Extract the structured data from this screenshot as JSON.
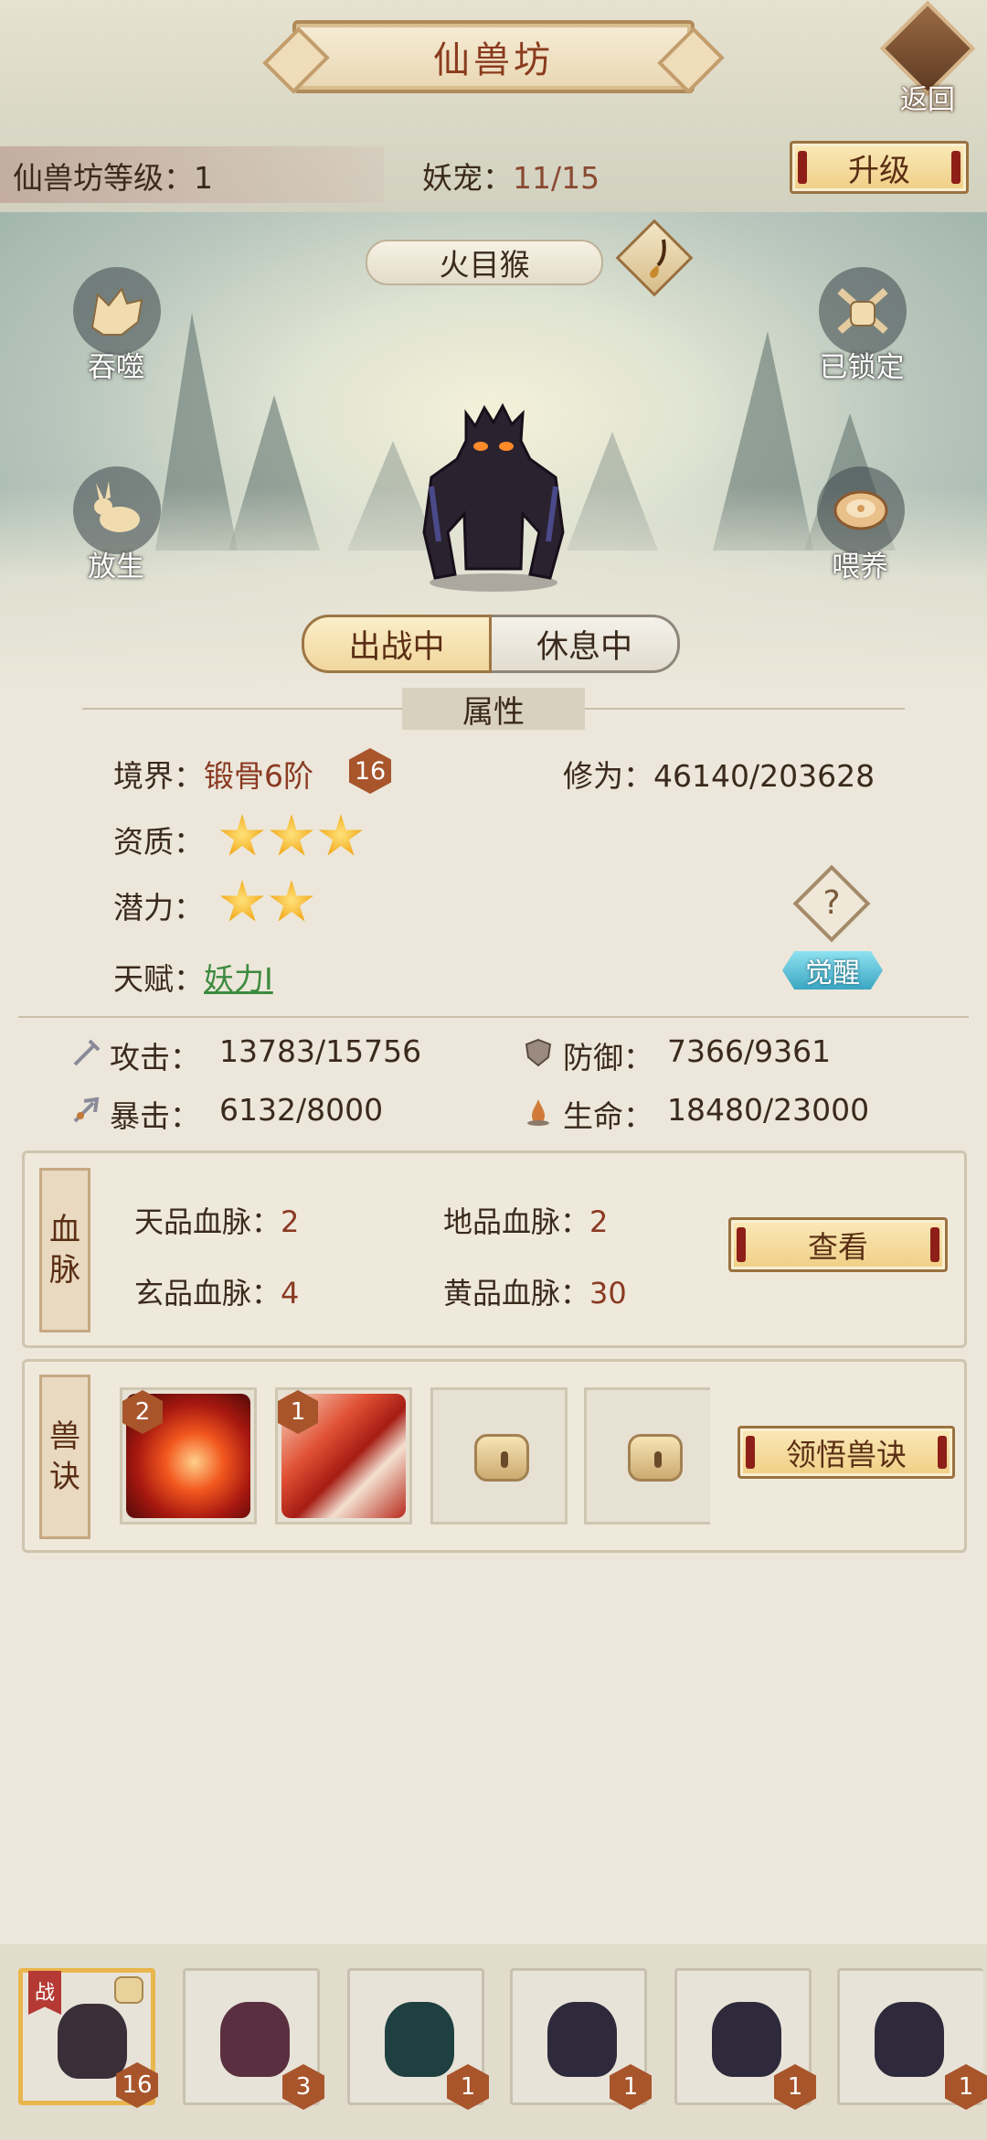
{
  "header": {
    "title": "仙兽坊",
    "back_label": "返回",
    "level_label": "仙兽坊等级：",
    "level_value": "1",
    "pet_label": "妖宠：",
    "pet_value": "11/15",
    "upgrade_label": "升级"
  },
  "pet": {
    "name": "火目猴",
    "actions": {
      "devour": "吞噬",
      "locked": "已锁定",
      "release": "放生",
      "feed": "喂养"
    },
    "status_active": "出战中",
    "status_rest": "休息中"
  },
  "attributes": {
    "title": "属性",
    "realm_label": "境界：",
    "realm_value": "锻骨6阶",
    "realm_level": "16",
    "cultivation_label": "修为：",
    "cultivation_value": "46140/203628",
    "aptitude_label": "资质：",
    "aptitude_stars": 3,
    "potential_label": "潜力：",
    "potential_stars": 2,
    "talent_label": "天赋：",
    "talent_value": "妖力Ⅰ",
    "help_icon": "?",
    "awaken_label": "觉醒"
  },
  "stats": {
    "attack_label": "攻击：",
    "attack_value": "13783/15756",
    "defense_label": "防御：",
    "defense_value": "7366/9361",
    "crit_label": "暴击：",
    "crit_value": "6132/8000",
    "hp_label": "生命：",
    "hp_value": "18480/23000"
  },
  "bloodline": {
    "side_label_1": "血",
    "side_label_2": "脉",
    "tian_label": "天品血脉：",
    "tian_value": "2",
    "di_label": "地品血脉：",
    "di_value": "2",
    "xuan_label": "玄品血脉：",
    "xuan_value": "4",
    "huang_label": "黄品血脉：",
    "huang_value": "30",
    "view_label": "查看"
  },
  "skills": {
    "side_label_1": "兽",
    "side_label_2": "诀",
    "slots": [
      {
        "level": "2",
        "icon": "fire-spirit"
      },
      {
        "level": "1",
        "icon": "claw-strike"
      },
      {
        "icon": "lock-icon"
      },
      {
        "icon": "lock-icon"
      }
    ],
    "learn_label": "领悟兽诀"
  },
  "pet_bar": {
    "battle_tag": "战",
    "slots": [
      {
        "level": "16",
        "color": "#3a2e38"
      },
      {
        "level": "3",
        "color": "#5a3040"
      },
      {
        "level": "1",
        "color": "#1e4040"
      },
      {
        "level": "1",
        "color": "#2e2a3c"
      },
      {
        "level": "1",
        "color": "#2e2a3c"
      },
      {
        "level": "1",
        "color": "#2e2a3c"
      }
    ]
  },
  "colors": {
    "accent_red": "#8a3a22",
    "gold_button": "#f0cf85",
    "talent_green": "#3b8a3e",
    "awaken_cyan": "#3aa6c2"
  }
}
